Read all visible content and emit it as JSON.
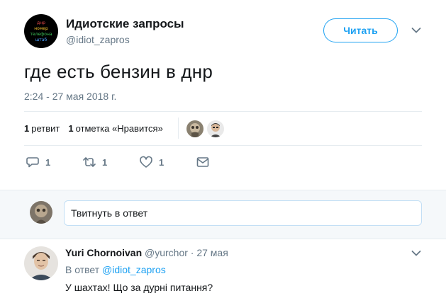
{
  "tweet": {
    "author_name": "Идиотские запросы",
    "author_handle": "@idiot_zapros",
    "avatar_words": [
      "днр",
      "номер",
      "телефона",
      "штаб"
    ],
    "follow_label": "Читать",
    "text": "где есть бензин в днр",
    "timestamp": "2:24 - 27 мая 2018 г."
  },
  "stats": {
    "retweets_count": "1",
    "retweets_label": "ретвит",
    "likes_count": "1",
    "likes_label": "отметка «Нравится»"
  },
  "actions": {
    "reply_count": "1",
    "retweet_count": "1",
    "like_count": "1"
  },
  "reply_box": {
    "placeholder": "Твитнуть в ответ"
  },
  "reply": {
    "name": "Yuri Chornoivan",
    "handle_time": "@yurchor · 27 мая",
    "reply_to_prefix": "В ответ",
    "reply_to_handle": "@idiot_zapros",
    "text": "У шахтах! Що за дурні питання?"
  },
  "colors": {
    "accent": "#1da1f2",
    "muted": "#657786",
    "divider": "#e6ecf0",
    "reply_bg": "#f5f8fa"
  },
  "icons": [
    "chevron-down-icon",
    "reply-icon",
    "retweet-icon",
    "like-icon",
    "direct-message-icon"
  ]
}
